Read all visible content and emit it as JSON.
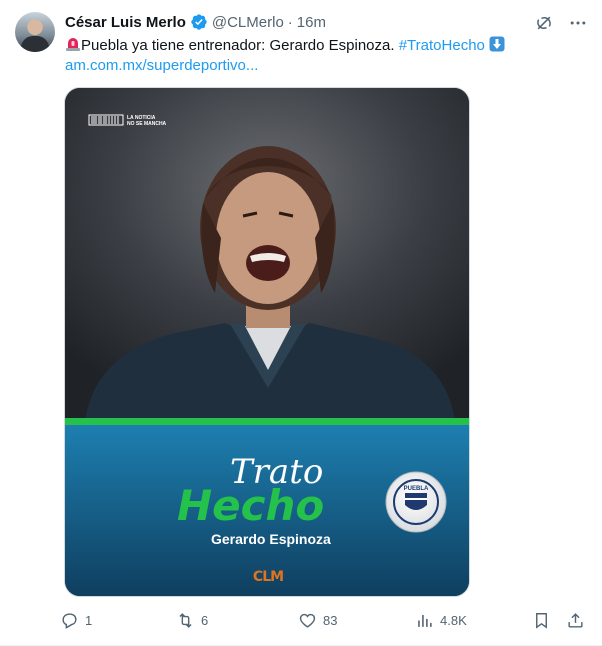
{
  "tweet": {
    "author_name": "César Luis Merlo",
    "handle": "@CLMerlo",
    "separator": "·",
    "time": "16m",
    "text_main": "Puebla ya tiene entrenador: Gerardo Espinoza.",
    "hashtag": "#TratoHecho",
    "link": "am.com.mx/superdeportivo...",
    "icons": {
      "verified": "verified-badge-icon",
      "siren": "siren-emoji",
      "down": "down-arrow-emoji"
    }
  },
  "media": {
    "tag_line1": "LA NOTICIA",
    "tag_line2": "NO SE MANCHA",
    "headline_top": "Trato",
    "headline_bottom": "Hecho",
    "person_name": "Gerardo Espinoza",
    "crest_text": "PUEBLA",
    "logo_text": "CLM",
    "colors": {
      "green": "#24c24a",
      "blue": "#1a6f9c",
      "dark": "#1c2a33"
    }
  },
  "actions": {
    "reply_count": "1",
    "retweet_count": "6",
    "like_count": "83",
    "view_count": "4.8K"
  }
}
